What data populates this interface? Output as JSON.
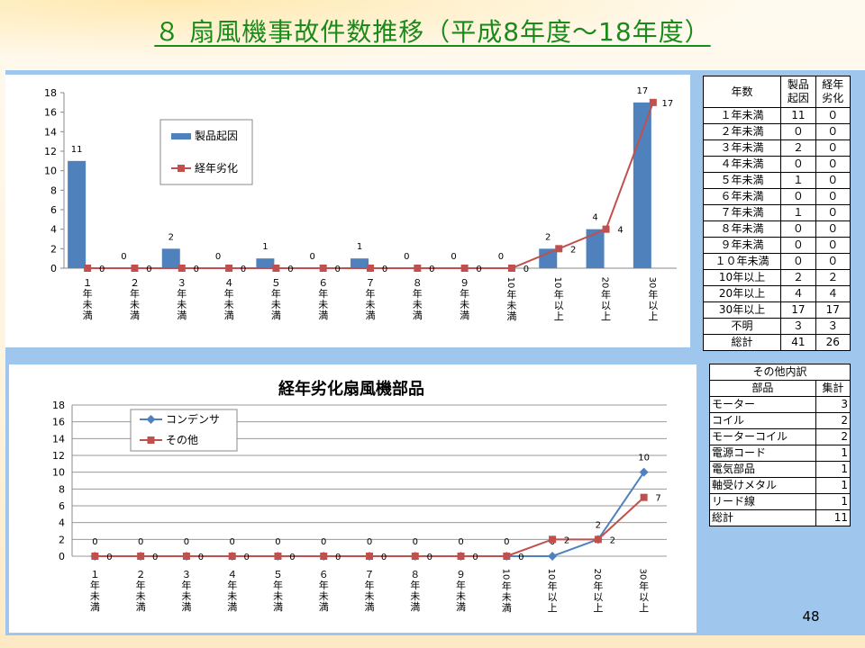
{
  "title": "８ 扇風機事故件数推移（平成8年度～18年度）",
  "page_number": "48",
  "colors": {
    "bar": "#4f81bd",
    "line_red": "#c0504d",
    "line_blue": "#4f81bd",
    "title_green": "#1a8a1a",
    "panel": "#9fc6ec"
  },
  "chart_data": [
    {
      "type": "bar",
      "title": "",
      "categories": [
        "１年未満",
        "２年未満",
        "３年未満",
        "４年未満",
        "５年未満",
        "６年未満",
        "７年未満",
        "８年未満",
        "９年未満",
        "10年未満",
        "10年以上",
        "20年以上",
        "30年以上"
      ],
      "ylim": [
        0,
        18
      ],
      "yticks": [
        0,
        2,
        4,
        6,
        8,
        10,
        12,
        14,
        16,
        18
      ],
      "grid": false,
      "legend": "upper-left-center",
      "series": [
        {
          "name": "製品起因",
          "type": "bar",
          "color": "#4f81bd",
          "values": [
            11,
            0,
            2,
            0,
            1,
            0,
            1,
            0,
            0,
            0,
            2,
            4,
            17
          ]
        },
        {
          "name": "経年劣化",
          "type": "line",
          "color": "#c0504d",
          "values": [
            0,
            0,
            0,
            0,
            0,
            0,
            0,
            0,
            0,
            0,
            2,
            4,
            17
          ]
        }
      ]
    },
    {
      "type": "line",
      "title": "経年劣化扇風機部品",
      "categories": [
        "１年未満",
        "２年未満",
        "３年未満",
        "４年未満",
        "５年未満",
        "６年未満",
        "７年未満",
        "８年未満",
        "９年未満",
        "10年未満",
        "10年以上",
        "20年以上",
        "30年以上"
      ],
      "ylim": [
        0,
        18
      ],
      "yticks": [
        0,
        2,
        4,
        6,
        8,
        10,
        12,
        14,
        16,
        18
      ],
      "grid": true,
      "legend": "upper-left",
      "series": [
        {
          "name": "コンデンサ",
          "color": "#4f81bd",
          "marker": "diamond",
          "values": [
            0,
            0,
            0,
            0,
            0,
            0,
            0,
            0,
            0,
            0,
            0,
            2,
            10
          ]
        },
        {
          "name": "その他",
          "color": "#c0504d",
          "marker": "square",
          "values": [
            0,
            0,
            0,
            0,
            0,
            0,
            0,
            0,
            0,
            0,
            2,
            2,
            7
          ]
        }
      ]
    }
  ],
  "table1": {
    "headers": [
      "年数",
      "製品\n起因",
      "経年\n劣化"
    ],
    "rows": [
      [
        "１年未満",
        "11",
        "０"
      ],
      [
        "２年未満",
        "０",
        "０"
      ],
      [
        "３年未満",
        "２",
        "０"
      ],
      [
        "４年未満",
        "０",
        "０"
      ],
      [
        "５年未満",
        "１",
        "０"
      ],
      [
        "６年未満",
        "０",
        "０"
      ],
      [
        "７年未満",
        "１",
        "０"
      ],
      [
        "８年未満",
        "０",
        "０"
      ],
      [
        "９年未満",
        "０",
        "０"
      ],
      [
        "１０年未満",
        "０",
        "０"
      ],
      [
        "10年以上",
        "２",
        "２"
      ],
      [
        "20年以上",
        "４",
        "４"
      ],
      [
        "30年以上",
        "17",
        "17"
      ],
      [
        "不明",
        "３",
        "３"
      ],
      [
        "総計",
        "41",
        "26"
      ]
    ]
  },
  "table2": {
    "caption": "その他内訳",
    "headers": [
      "部品",
      "集計"
    ],
    "rows": [
      [
        "モーター",
        "3"
      ],
      [
        "コイル",
        "2"
      ],
      [
        "モーターコイル",
        "2"
      ],
      [
        "電源コード",
        "1"
      ],
      [
        "電気部品",
        "1"
      ],
      [
        "軸受けメタル",
        "1"
      ],
      [
        "リード線",
        "1"
      ],
      [
        "総計",
        "11"
      ]
    ]
  }
}
